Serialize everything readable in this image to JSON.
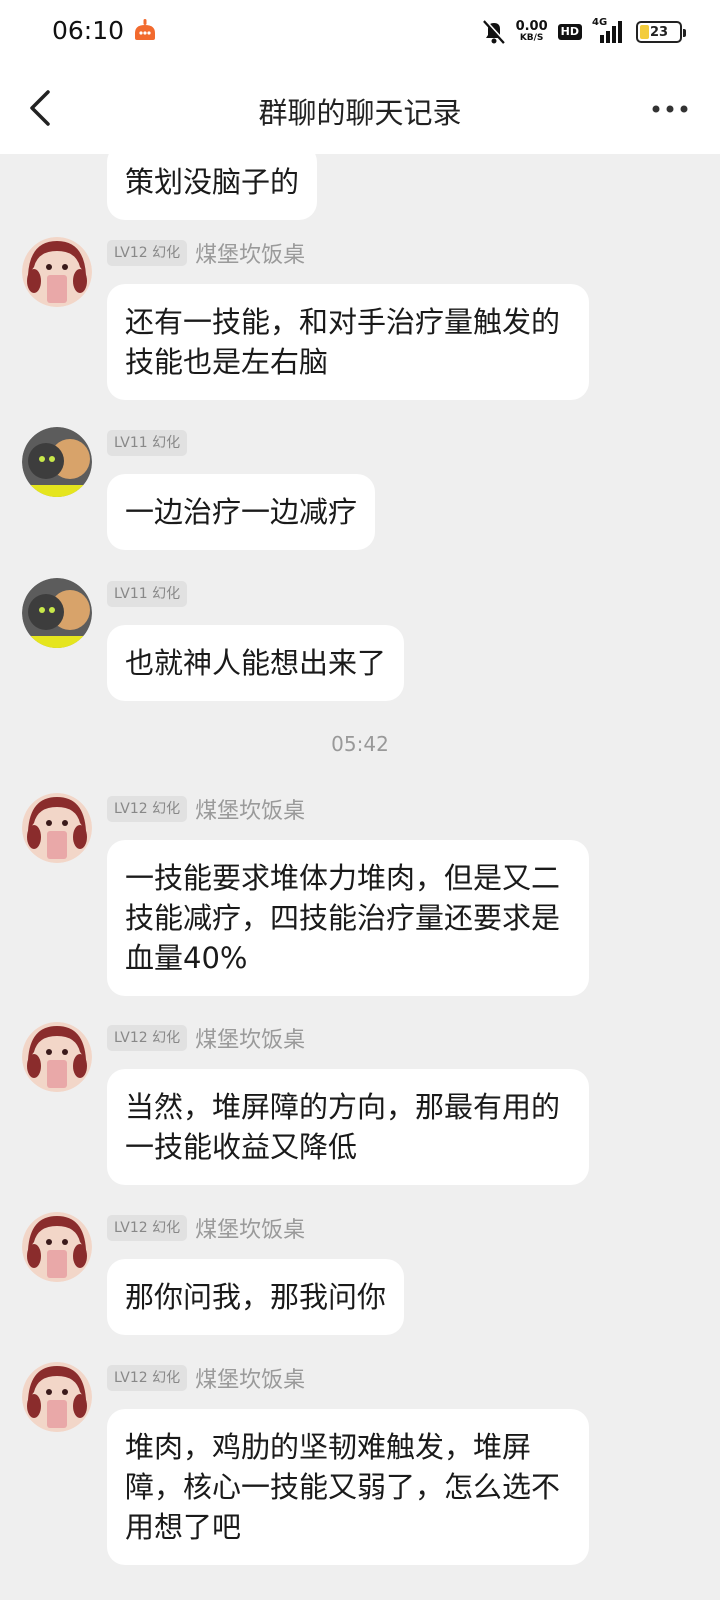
{
  "status_bar": {
    "time": "06:10",
    "net_speed_value": "0.00",
    "net_speed_unit": "KB/S",
    "hd": "HD",
    "network": "4G",
    "battery": "23",
    "battery_level": 0.23,
    "icons": [
      "app-notification-icon",
      "mute-bell-icon",
      "signal-icon",
      "battery-icon"
    ]
  },
  "nav": {
    "title": "群聊的聊天记录",
    "icons": [
      "back-arrow-icon",
      "more-dots-icon"
    ]
  },
  "messages": [
    {
      "text": "策划没脑子的"
    },
    {
      "level": "LV12 幻化",
      "sender": "煤堡坎饭桌",
      "text": "还有一技能，和对手治疗量触发的技能也是左右脑"
    },
    {
      "level": "LV11 幻化",
      "sender": "",
      "text": "一边治疗一边减疗"
    },
    {
      "level": "LV11 幻化",
      "sender": "",
      "text": "也就神人能想出来了"
    },
    {
      "level": "LV12 幻化",
      "sender": "煤堡坎饭桌",
      "text": "一技能要求堆体力堆肉，但是又二技能减疗，四技能治疗量还要求是血量40%"
    },
    {
      "level": "LV12 幻化",
      "sender": "煤堡坎饭桌",
      "text": "当然，堆屏障的方向，那最有用的一技能收益又降低"
    },
    {
      "level": "LV12 幻化",
      "sender": "煤堡坎饭桌",
      "text": "那你问我，那我问你"
    },
    {
      "level": "LV12 幻化",
      "sender": "煤堡坎饭桌",
      "text": "堆肉，鸡肋的坚韧难触发，堆屏障，核心一技能又弱了，怎么选不用想了吧"
    }
  ],
  "timestamp": "05:42"
}
